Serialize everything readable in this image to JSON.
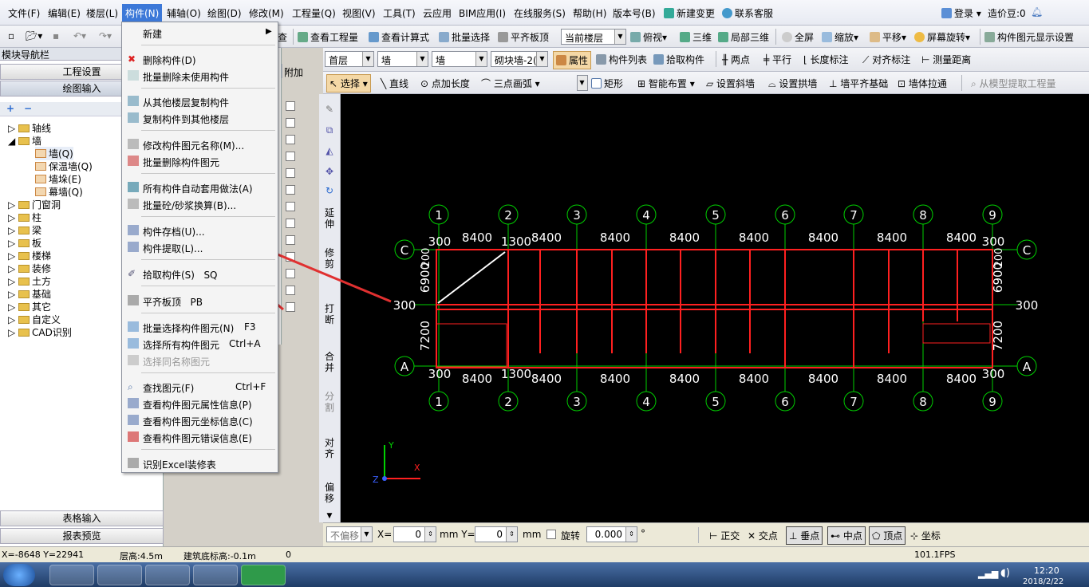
{
  "menubar": {
    "items": [
      "文件(F)",
      "编辑(E)",
      "楼层(L)",
      "构件(N)",
      "辅轴(O)",
      "绘图(D)",
      "修改(M)",
      "工程量(Q)",
      "视图(V)",
      "工具(T)",
      "云应用",
      "BIM应用(I)",
      "在线服务(S)",
      "帮助(H)",
      "版本号(B)"
    ],
    "new_change": "新建变更",
    "support": "联系客服",
    "login": "登录",
    "beans": "造价豆:0"
  },
  "toolbar1": {
    "view_quantity": "查看工程量",
    "view_formula": "查看计算式",
    "batch_select": "批量选择",
    "align_top": "平齐板顶",
    "floor_combo": "当前楼层",
    "top_view": "俯视",
    "three_d": "三维",
    "local_3d": "局部三维",
    "full_screen": "全屏",
    "zoom": "缩放",
    "pan": "平移",
    "rotate": "屏幕旋转",
    "display_settings": "构件图元显示设置",
    "check": "查"
  },
  "toolbar2": {
    "floor": "首层",
    "type": "墙",
    "subtype": "墙",
    "component": "砌块墙-2(",
    "properties": "属性",
    "component_list": "构件列表",
    "pick": "拾取构件",
    "two_points": "两点",
    "parallel": "平行",
    "length_dim": "长度标注",
    "align_dim": "对齐标注",
    "measure": "测量距离"
  },
  "toolbar3": {
    "select": "选择",
    "line": "直线",
    "point_length": "点加长度",
    "arc": "三点画弧",
    "rect": "矩形",
    "smart_layout": "智能布置",
    "slope_wall": "设置斜墙",
    "arch_wall": "设置拱墙",
    "wall_base": "墙平齐基础",
    "wall_pull": "墙体拉通",
    "extract_model": "从模型提取工程量"
  },
  "leftpanel": {
    "title": "模块导航栏",
    "pin": "ㅁ ×",
    "project_settings": "工程设置",
    "drawing_input": "绘图输入",
    "tree": [
      "轴线",
      "墙",
      "墙(Q)",
      "保温墙(Q)",
      "墙垛(E)",
      "幕墙(Q)",
      "门窗洞",
      "柱",
      "梁",
      "板",
      "楼梯",
      "装修",
      "土方",
      "基础",
      "其它",
      "自定义",
      "CAD识别"
    ],
    "table_input": "表格输入",
    "report_preview": "报表预览",
    "attach": "附加"
  },
  "dropmenu": {
    "items": [
      "新建",
      "删除构件(D)",
      "批量删除未使用构件",
      "从其他楼层复制构件",
      "复制构件到其他楼层",
      "修改构件图元名称(M)...",
      "批量删除构件图元",
      "所有构件自动套用做法(A)",
      "批量砼/砂浆换算(B)...",
      "构件存档(U)...",
      "构件提取(L)...",
      "拾取构件(S)",
      "平齐板顶",
      "批量选择构件图元(N)",
      "选择所有构件图元",
      "选择同名称图元",
      "查找图元(F)",
      "查看构件图元属性信息(P)",
      "查看构件图元坐标信息(C)",
      "查看构件图元错误信息(E)",
      "识别Excel装修表"
    ],
    "shortcuts": {
      "pick": "SQ",
      "align": "PB",
      "batch": "F3",
      "selall": "Ctrl+A",
      "find": "Ctrl+F"
    }
  },
  "vtools": [
    "延伸",
    "修剪",
    "打断",
    "合并",
    "分割",
    "对齐",
    "偏移"
  ],
  "drawing": {
    "axes_top": [
      "1",
      "2",
      "3",
      "4",
      "5",
      "6",
      "7",
      "8",
      "9"
    ],
    "axes_side": [
      "C",
      "A"
    ],
    "spans": [
      "8400",
      "8400",
      "8400",
      "8400",
      "8400",
      "8400",
      "8400",
      "8400"
    ],
    "dims": {
      "d300": "300",
      "d1300": "1300",
      "d200": "200",
      "d6900": "6900",
      "d7200": "7200"
    },
    "axis_color": "#00d000",
    "wall_color": "#ff2020"
  },
  "statusbar": {
    "offset": "不偏移",
    "x_label": "X=",
    "x_val": "0",
    "y_label": "mm Y=",
    "y_val": "0",
    "mm": "mm",
    "rotate": "旋转",
    "rot_val": "0.000",
    "deg": "°",
    "ortho": "正交",
    "intersect": "交点",
    "perp": "垂点",
    "mid": "中点",
    "vertex": "顶点",
    "coord": "坐标"
  },
  "coordbar": {
    "xy": "X=-8648 Y=22941",
    "height": "层高:4.5m",
    "base": "建筑底标高:-0.1m",
    "zero": "0",
    "fps": "101.1FPS"
  },
  "taskbar": {
    "time": "12:20",
    "date": "2018/2/22"
  }
}
